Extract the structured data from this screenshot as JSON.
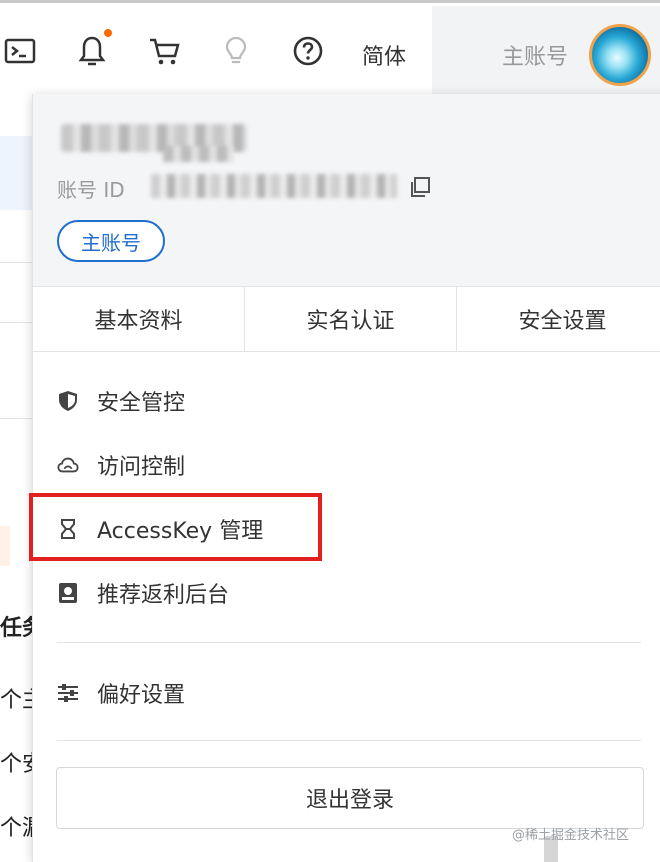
{
  "topbar": {
    "language_label": "简体",
    "account_label": "主账号",
    "icons": [
      "terminal-icon",
      "bell-icon",
      "cart-icon",
      "lightbulb-icon",
      "help-icon"
    ],
    "notification_dot_color": "#ff6a00"
  },
  "background": {
    "text_fragments": [
      "任务",
      "个主",
      "个安",
      "个漏"
    ]
  },
  "dropdown": {
    "account_id_label": "账号 ID",
    "account_type_badge": "主账号",
    "tabs": [
      {
        "label": "基本资料"
      },
      {
        "label": "实名认证"
      },
      {
        "label": "安全设置"
      }
    ],
    "menu": [
      {
        "label": "安全管控",
        "icon": "shield-icon"
      },
      {
        "label": "访问控制",
        "icon": "cloud-icon"
      },
      {
        "label": "AccessKey 管理",
        "icon": "key-icon"
      },
      {
        "label": "推荐返利后台",
        "icon": "rebate-icon"
      },
      {
        "label": "偏好设置",
        "icon": "sliders-icon"
      }
    ],
    "logout_label": "退出登录",
    "highlight_color": "#e22020",
    "accent_color": "#1f6fd1"
  },
  "watermark": "@稀土掘金技术社区"
}
